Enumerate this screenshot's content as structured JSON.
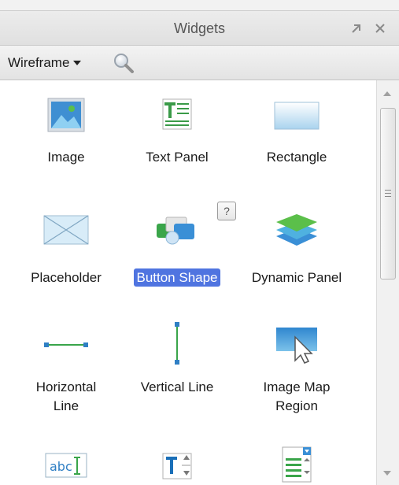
{
  "panel": {
    "title": "Widgets",
    "pin_icon": "pin-icon",
    "close_icon": "close-icon"
  },
  "toolbar": {
    "library": "Wireframe",
    "search_icon": "search-icon"
  },
  "widgets": [
    {
      "label": "Image",
      "icon": "image-icon"
    },
    {
      "label": "Text Panel",
      "icon": "text-panel-icon"
    },
    {
      "label": "Rectangle",
      "icon": "rectangle-icon"
    },
    {
      "label": "Placeholder",
      "icon": "placeholder-icon"
    },
    {
      "label": "Button Shape",
      "icon": "button-shape-icon",
      "selected": true
    },
    {
      "label": "Dynamic Panel",
      "icon": "dynamic-panel-icon"
    },
    {
      "label": "Horizontal Line",
      "label_line1": "Horizontal",
      "label_line2": "Line",
      "icon": "horizontal-line-icon"
    },
    {
      "label": "Vertical Line",
      "icon": "vertical-line-icon"
    },
    {
      "label": "Image Map Region",
      "label_line1": "Image Map",
      "label_line2": "Region",
      "icon": "image-map-region-icon"
    },
    {
      "icon": "text-field-icon"
    },
    {
      "icon": "text-area-icon"
    },
    {
      "icon": "droplist-icon"
    }
  ],
  "help_badge": "?",
  "colors": {
    "selection": "#4f74e0",
    "accent_blue": "#3a8fd6",
    "accent_green": "#3aa54a"
  }
}
